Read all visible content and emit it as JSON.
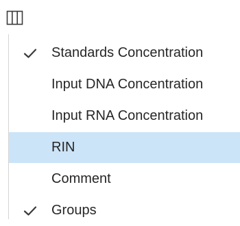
{
  "toolbar": {
    "columns_icon": "columns-icon"
  },
  "menu": {
    "items": [
      {
        "label": "Standards Concentration",
        "checked": true,
        "selected": false
      },
      {
        "label": "Input DNA Concentration",
        "checked": false,
        "selected": false
      },
      {
        "label": "Input RNA Concentration",
        "checked": false,
        "selected": false
      },
      {
        "label": "RIN",
        "checked": false,
        "selected": true
      },
      {
        "label": "Comment",
        "checked": false,
        "selected": false
      },
      {
        "label": "Groups",
        "checked": true,
        "selected": false
      }
    ]
  },
  "colors": {
    "highlight": "#cce4f7",
    "check": "#3a3a3a",
    "text": "#262626"
  }
}
